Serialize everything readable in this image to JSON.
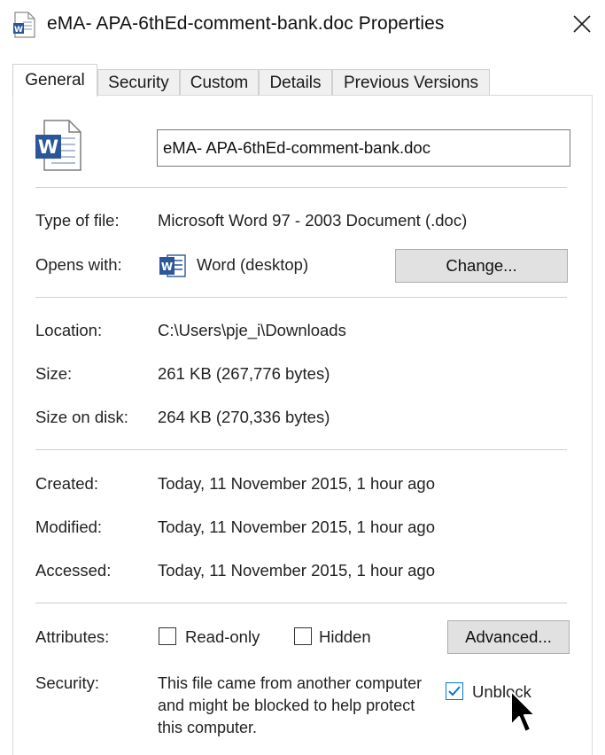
{
  "window": {
    "title": "eMA- APA-6thEd-comment-bank.doc Properties"
  },
  "tabs": [
    {
      "label": "General"
    },
    {
      "label": "Security"
    },
    {
      "label": "Custom"
    },
    {
      "label": "Details"
    },
    {
      "label": "Previous Versions"
    }
  ],
  "general": {
    "file_name": "eMA- APA-6thEd-comment-bank.doc",
    "type_label": "Type of file:",
    "type_value": "Microsoft Word 97 - 2003 Document (.doc)",
    "opens_label": "Opens with:",
    "opens_value": "Word (desktop)",
    "change_button": "Change...",
    "location_label": "Location:",
    "location_value": "C:\\Users\\pje_i\\Downloads",
    "size_label": "Size:",
    "size_value": "261 KB (267,776 bytes)",
    "size_disk_label": "Size on disk:",
    "size_disk_value": "264 KB (270,336 bytes)",
    "created_label": "Created:",
    "created_value": "Today, 11 November 2015, 1 hour ago",
    "modified_label": "Modified:",
    "modified_value": "Today, 11 November 2015, 1 hour ago",
    "accessed_label": "Accessed:",
    "accessed_value": "Today, 11 November 2015, 1 hour ago",
    "attributes_label": "Attributes:",
    "readonly_label": "Read-only",
    "readonly_checked": false,
    "hidden_label": "Hidden",
    "hidden_checked": false,
    "advanced_button": "Advanced...",
    "security_label": "Security:",
    "security_text": "This file came from another computer and might be blocked to help protect this computer.",
    "unblock_label": "Unblock",
    "unblock_checked": true
  },
  "colors": {
    "word_blue": "#2b579a",
    "check_blue": "#0078d7"
  },
  "icons": {
    "title": "word-document-icon",
    "close": "close-icon",
    "file": "word-document-large-icon",
    "app": "word-app-icon",
    "checkmark": "checkmark-icon",
    "cursor": "mouse-pointer-icon"
  }
}
